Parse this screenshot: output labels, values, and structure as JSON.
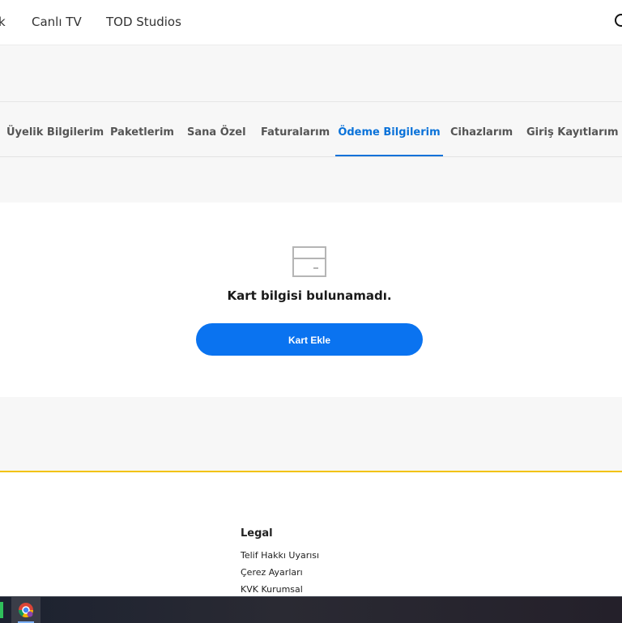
{
  "topnav": {
    "partial_item": "k",
    "items": [
      "Canlı TV",
      "TOD Studios"
    ],
    "search_icon": "search-icon"
  },
  "account_tabs": [
    {
      "label": "Üyelik Bilgilerim",
      "active": false
    },
    {
      "label": "Paketlerim",
      "active": false
    },
    {
      "label": "Sana Özel",
      "active": false
    },
    {
      "label": "Faturalarım",
      "active": false
    },
    {
      "label": "Ödeme Bilgilerim",
      "active": true
    },
    {
      "label": "Cihazlarım",
      "active": false
    },
    {
      "label": "Giriş Kayıtlarım",
      "active": false
    }
  ],
  "payment": {
    "card_icon": "credit-card-icon",
    "empty_message": "Kart bilgisi bulunamadı.",
    "add_card_label": "Kart Ekle"
  },
  "footer": {
    "legal_title": "Legal",
    "links": [
      "Telif Hakkı Uyarısı",
      "Çerez Ayarları",
      "KVK Kurumsal"
    ]
  },
  "taskbar": {
    "app_icon": "chrome-icon"
  },
  "colors": {
    "accent": "#0a72d9",
    "button": "#0a73f0",
    "footer_rule": "#f2c200",
    "band": "#f7f7f7"
  }
}
